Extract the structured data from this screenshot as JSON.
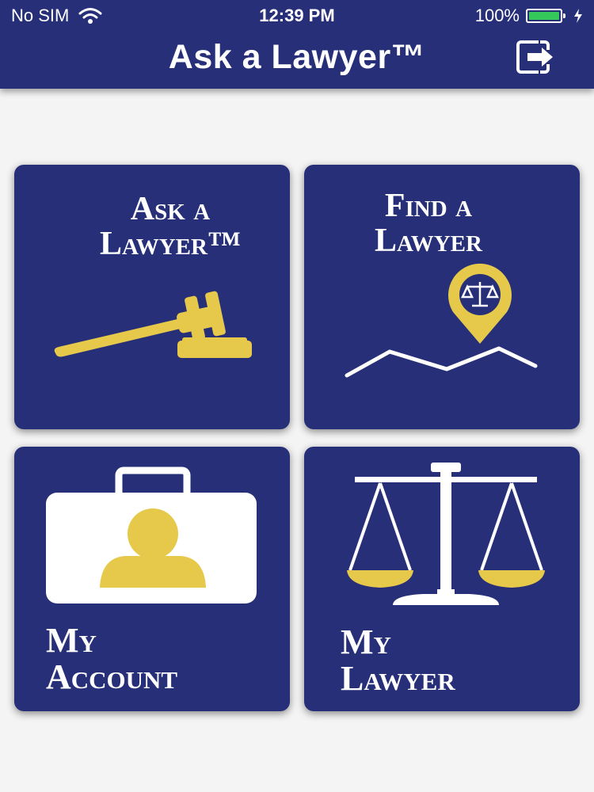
{
  "status_bar": {
    "carrier": "No SIM",
    "time": "12:39 PM",
    "battery": "100%",
    "battery_level": 1.0
  },
  "header": {
    "title": "Ask a Lawyer™",
    "exit_icon": "exit-icon"
  },
  "tiles": [
    {
      "line1": "Ask a",
      "line2": "Lawyer™",
      "icon": "gavel-icon"
    },
    {
      "line1": "Find a",
      "line2": "Lawyer",
      "icon": "map-pin-icon"
    },
    {
      "line1": "My",
      "line2": "Account",
      "icon": "briefcase-user-icon"
    },
    {
      "line1": "My",
      "line2": "Lawyer",
      "icon": "scales-of-justice-icon"
    }
  ],
  "colors": {
    "navy": "#262f78",
    "gold": "#e6c84a",
    "white": "#ffffff",
    "background": "#f4f4f4"
  }
}
